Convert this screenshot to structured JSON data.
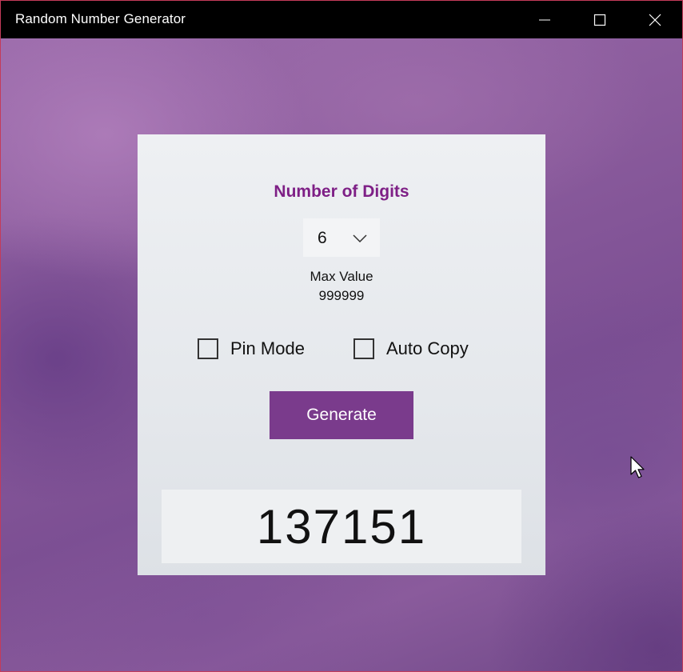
{
  "window": {
    "title": "Random Number Generator",
    "controls": {
      "minimize": "minimize-icon",
      "maximize": "maximize-icon",
      "close": "close-icon"
    }
  },
  "settings": {
    "digits_label": "Number of Digits",
    "digits_selected": "6",
    "max_label": "Max Value",
    "max_value": "999999"
  },
  "options": {
    "pin_mode": {
      "label": "Pin Mode",
      "checked": false
    },
    "auto_copy": {
      "label": "Auto Copy",
      "checked": false
    }
  },
  "actions": {
    "generate_label": "Generate"
  },
  "result": {
    "value": "137151"
  },
  "colors": {
    "accent": "#7e1f86",
    "button": "#7a3b8c",
    "titlebar": "#000000"
  }
}
